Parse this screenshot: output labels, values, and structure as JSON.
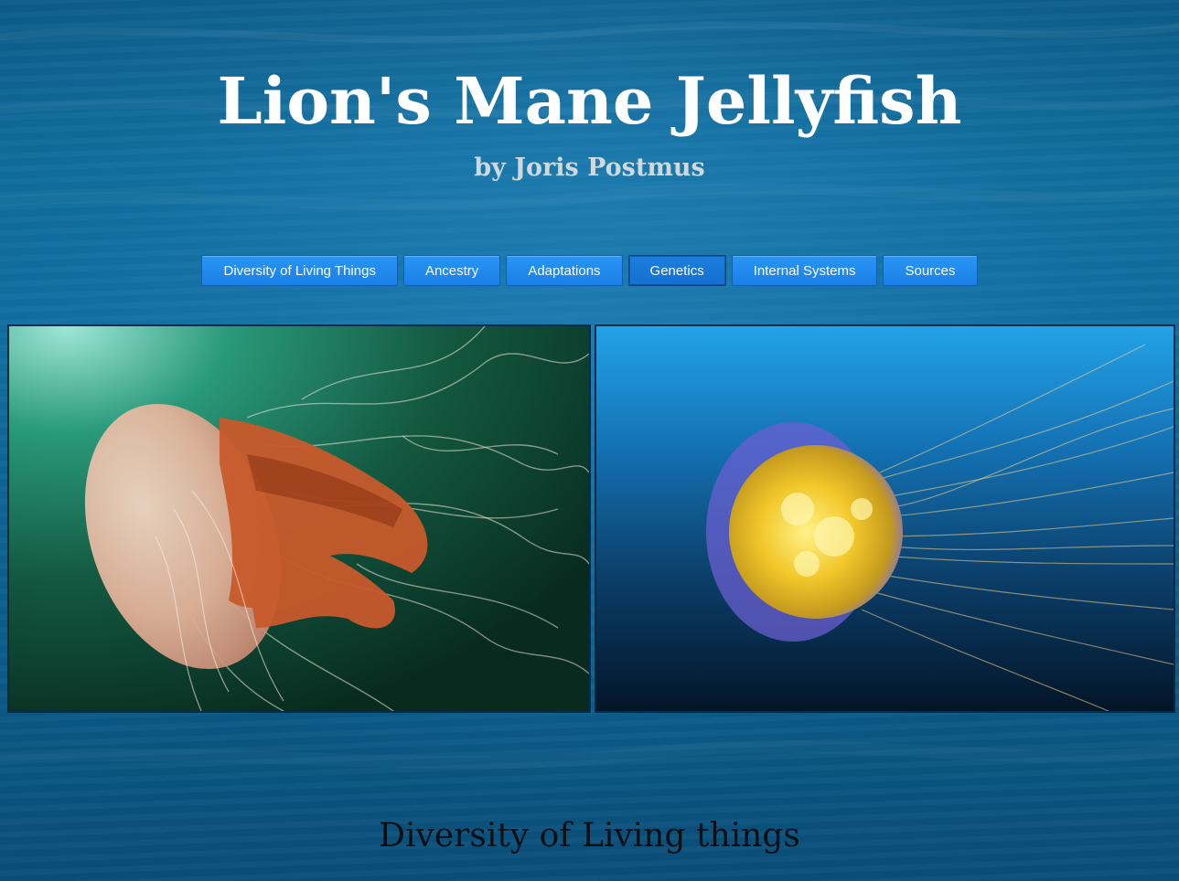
{
  "header": {
    "title": "Lion's Mane Jellyfish",
    "subtitle": "by Joris Postmus"
  },
  "nav": {
    "items": [
      {
        "label": "Diversity of Living Things"
      },
      {
        "label": "Ancestry"
      },
      {
        "label": "Adaptations"
      },
      {
        "label": "Genetics",
        "active": true
      },
      {
        "label": "Internal Systems"
      },
      {
        "label": "Sources"
      }
    ]
  },
  "gallery": {
    "images": [
      {
        "name": "jellyfish-photo-green-water"
      },
      {
        "name": "jellyfish-photo-blue-water"
      }
    ]
  },
  "section": {
    "heading": "Diversity of Living things"
  },
  "colors": {
    "background": "#0f6d9e",
    "nav_button": "#1f88ee",
    "title_text": "#ffffff",
    "subtitle_text": "#cfd8de",
    "heading_text": "#0a0f14"
  }
}
